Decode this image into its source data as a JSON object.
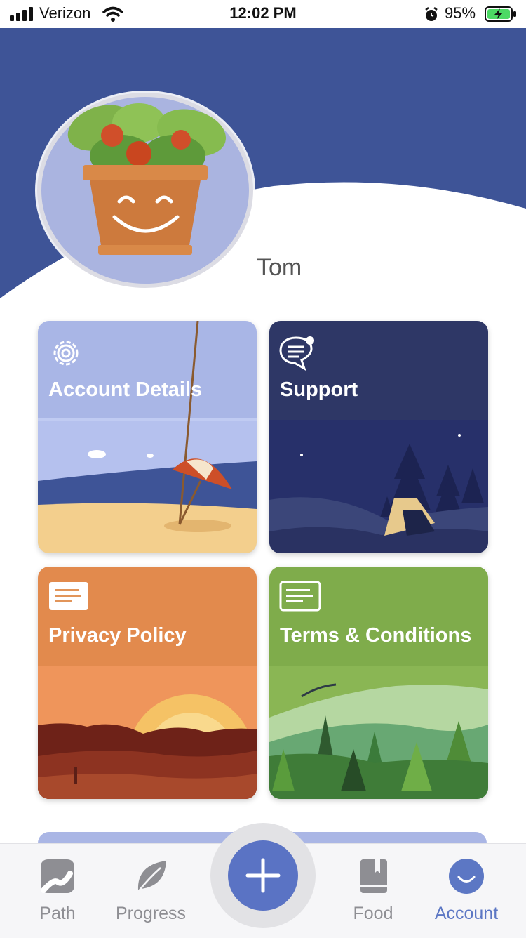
{
  "status_bar": {
    "carrier": "Verizon",
    "time": "12:02 PM",
    "battery": "95%"
  },
  "profile": {
    "name": "Tom",
    "avatar": "smiling-plant-pot"
  },
  "cards": [
    {
      "title": "Account Details",
      "icon": "gear-icon",
      "scene": "beach"
    },
    {
      "title": "Support",
      "icon": "chat-bubble-icon",
      "scene": "night-camping"
    },
    {
      "title": "Privacy Policy",
      "icon": "document-icon",
      "scene": "desert-sunset"
    },
    {
      "title": "Terms & Conditions",
      "icon": "document-icon",
      "scene": "forest-mountains"
    }
  ],
  "tabs": [
    {
      "label": "Path",
      "icon": "path-icon",
      "active": false
    },
    {
      "label": "Progress",
      "icon": "leaf-icon",
      "active": false
    },
    {
      "label": "Food",
      "icon": "book-icon",
      "active": false
    },
    {
      "label": "Account",
      "icon": "smile-icon",
      "active": true
    }
  ],
  "fab": {
    "icon": "plus-icon"
  },
  "colors": {
    "header_blue": "#3e5497",
    "active_tab": "#5c77c4",
    "inactive_tab": "#8e8e93",
    "fab": "#5a73c4"
  }
}
